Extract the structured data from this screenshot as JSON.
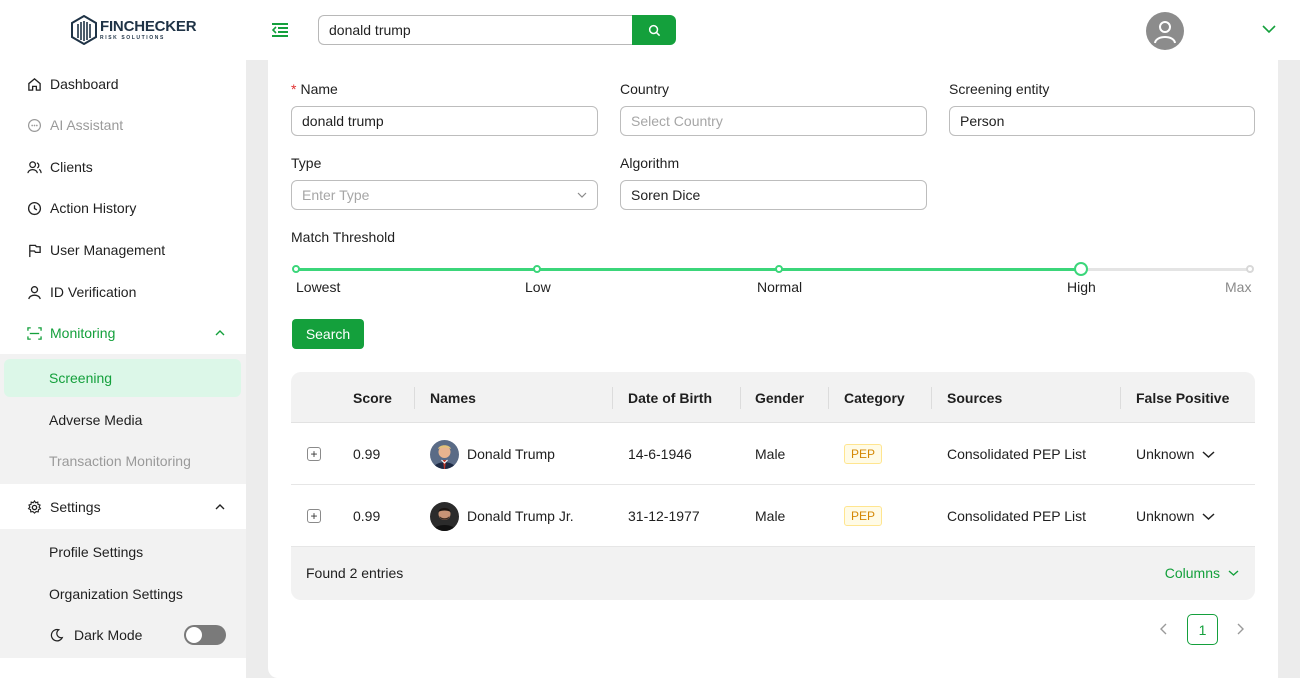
{
  "brand": {
    "name": "FINCHECKER",
    "tagline": "RISK SOLUTIONS"
  },
  "header": {
    "search_value": "donald trump"
  },
  "sidebar": {
    "items": [
      {
        "label": "Dashboard",
        "icon": "home-icon"
      },
      {
        "label": "AI Assistant",
        "icon": "chat-icon",
        "disabled": true
      },
      {
        "label": "Clients",
        "icon": "clients-icon"
      },
      {
        "label": "Action History",
        "icon": "history-icon"
      },
      {
        "label": "User Management",
        "icon": "flag-icon"
      },
      {
        "label": "ID Verification",
        "icon": "user-icon"
      },
      {
        "label": "Monitoring",
        "icon": "monitoring-icon",
        "expanded": true
      }
    ],
    "monitoring_sub": [
      {
        "label": "Screening",
        "active": true
      },
      {
        "label": "Adverse Media"
      },
      {
        "label": "Transaction Monitoring",
        "disabled": true
      }
    ],
    "settings": {
      "label": "Settings",
      "icon": "gear-icon",
      "expanded": true
    },
    "settings_sub": [
      {
        "label": "Profile Settings"
      },
      {
        "label": "Organization Settings"
      }
    ],
    "dark_mode": {
      "label": "Dark Mode",
      "enabled": false
    }
  },
  "form": {
    "name_label": "Name",
    "name_value": "donald trump",
    "country_label": "Country",
    "country_placeholder": "Select Country",
    "entity_label": "Screening entity",
    "entity_value": "Person",
    "type_label": "Type",
    "type_placeholder": "Enter Type",
    "algorithm_label": "Algorithm",
    "algorithm_value": "Soren Dice",
    "threshold_label": "Match Threshold",
    "threshold_marks": [
      "Lowest",
      "Low",
      "Normal",
      "High",
      "Max"
    ],
    "threshold_selected": "High",
    "search_label": "Search"
  },
  "table": {
    "headers": {
      "score": "Score",
      "names": "Names",
      "dob": "Date of Birth",
      "gender": "Gender",
      "category": "Category",
      "sources": "Sources",
      "false_positive": "False Positive"
    },
    "rows": [
      {
        "score": "0.99",
        "name": "Donald Trump",
        "dob": "14-6-1946",
        "gender": "Male",
        "category": "PEP",
        "source": "Consolidated PEP List",
        "false_positive": "Unknown"
      },
      {
        "score": "0.99",
        "name": "Donald Trump Jr.",
        "dob": "31-12-1977",
        "gender": "Male",
        "category": "PEP",
        "source": "Consolidated PEP List",
        "false_positive": "Unknown"
      }
    ],
    "footer": {
      "found": "Found 2 entries",
      "columns": "Columns"
    }
  },
  "pagination": {
    "current": "1"
  },
  "colors": {
    "accent": "#14a03c",
    "slider": "#3bd67a",
    "active_bg": "#dcf7e8"
  }
}
